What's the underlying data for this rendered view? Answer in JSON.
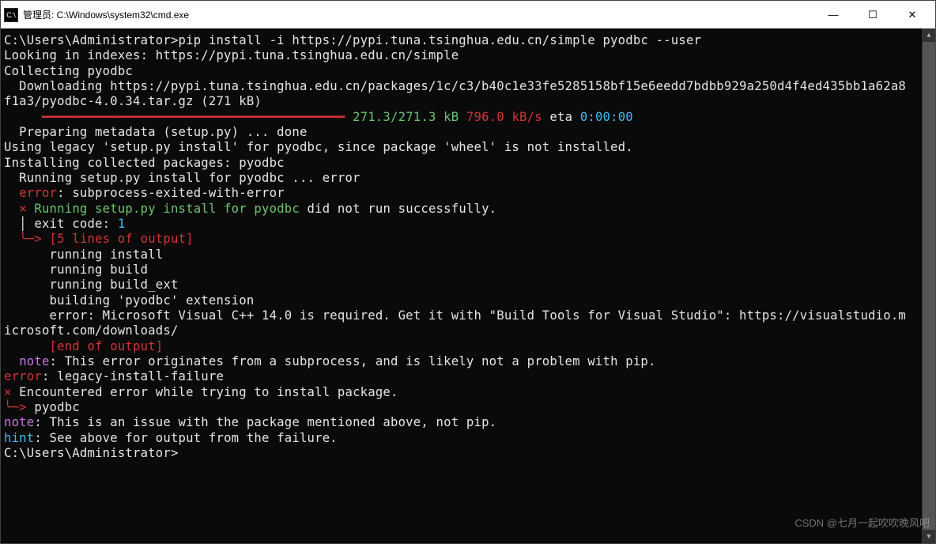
{
  "window": {
    "title": "管理员: C:\\Windows\\system32\\cmd.exe",
    "icon_label": "C:\\",
    "minimize": "—",
    "maximize": "☐",
    "close": "✕"
  },
  "scroll": {
    "up": "▲",
    "down": "▼"
  },
  "colors": {
    "red": "#d13438",
    "green": "#6bc46d",
    "cyan": "#3abff8",
    "magenta": "#c678dd",
    "white": "#e5e5e5"
  },
  "lines": [
    [
      {
        "t": "C:\\Users\\Administrator>pip install -i https://pypi.tuna.tsinghua.edu.cn/simple pyodbc --user",
        "c": "white"
      }
    ],
    [
      {
        "t": "Looking in indexes: https://pypi.tuna.tsinghua.edu.cn/simple",
        "c": "white"
      }
    ],
    [
      {
        "t": "Collecting pyodbc",
        "c": "white"
      }
    ],
    [
      {
        "t": "  Downloading https://pypi.tuna.tsinghua.edu.cn/packages/1c/c3/b40c1e33fe5285158bf15e6eedd7bdbb929a250d4f4ed435bb1a62a8f1a3/pyodbc-4.0.34.tar.gz (271 kB)",
        "c": "white"
      }
    ],
    [
      {
        "t": "     ",
        "c": "white"
      },
      {
        "t": "━━━━━━━━━━━━━━━━━━━━━━━━━━━━━━━━━━━━━━━━",
        "c": "red"
      },
      {
        "t": " ",
        "c": "white"
      },
      {
        "t": "271.3/271.3 kB",
        "c": "green"
      },
      {
        "t": " ",
        "c": "white"
      },
      {
        "t": "796.0 kB/s",
        "c": "red"
      },
      {
        "t": " eta ",
        "c": "white"
      },
      {
        "t": "0:00:00",
        "c": "cyan"
      }
    ],
    [
      {
        "t": "  Preparing metadata (setup.py) ... done",
        "c": "white"
      }
    ],
    [
      {
        "t": "Using legacy 'setup.py install' for pyodbc, since package 'wheel' is not installed.",
        "c": "white"
      }
    ],
    [
      {
        "t": "Installing collected packages: pyodbc",
        "c": "white"
      }
    ],
    [
      {
        "t": "  Running setup.py install for pyodbc ... error",
        "c": "white"
      }
    ],
    [
      {
        "t": "  ",
        "c": "white"
      },
      {
        "t": "error",
        "c": "red"
      },
      {
        "t": ": subprocess-exited-with-error",
        "c": "white"
      }
    ],
    [
      {
        "t": "",
        "c": "white"
      }
    ],
    [
      {
        "t": "  ",
        "c": "white"
      },
      {
        "t": "×",
        "c": "red"
      },
      {
        "t": " ",
        "c": "white"
      },
      {
        "t": "Running setup.py install for pyodbc",
        "c": "green"
      },
      {
        "t": " did not run successfully.",
        "c": "white"
      }
    ],
    [
      {
        "t": "  │ exit code: ",
        "c": "white"
      },
      {
        "t": "1",
        "c": "cyan"
      }
    ],
    [
      {
        "t": "  ",
        "c": "white"
      },
      {
        "t": "╰─>",
        "c": "red"
      },
      {
        "t": " ",
        "c": "white"
      },
      {
        "t": "[5 lines of output]",
        "c": "red"
      }
    ],
    [
      {
        "t": "      running install",
        "c": "white"
      }
    ],
    [
      {
        "t": "      running build",
        "c": "white"
      }
    ],
    [
      {
        "t": "      running build_ext",
        "c": "white"
      }
    ],
    [
      {
        "t": "      building 'pyodbc' extension",
        "c": "white"
      }
    ],
    [
      {
        "t": "      error: Microsoft Visual C++ 14.0 is required. Get it with \"Build Tools for Visual Studio\": https://visualstudio.microsoft.com/downloads/",
        "c": "white"
      }
    ],
    [
      {
        "t": "      ",
        "c": "white"
      },
      {
        "t": "[end of output]",
        "c": "red"
      }
    ],
    [
      {
        "t": "",
        "c": "white"
      }
    ],
    [
      {
        "t": "  ",
        "c": "white"
      },
      {
        "t": "note",
        "c": "magenta"
      },
      {
        "t": ": This error originates from a subprocess, and is likely not a problem with pip.",
        "c": "white"
      }
    ],
    [
      {
        "t": "error",
        "c": "red"
      },
      {
        "t": ": legacy-install-failure",
        "c": "white"
      }
    ],
    [
      {
        "t": "",
        "c": "white"
      }
    ],
    [
      {
        "t": "×",
        "c": "red"
      },
      {
        "t": " Encountered error while trying to install package.",
        "c": "white"
      }
    ],
    [
      {
        "t": "╰─>",
        "c": "red"
      },
      {
        "t": " pyodbc",
        "c": "white"
      }
    ],
    [
      {
        "t": "",
        "c": "white"
      }
    ],
    [
      {
        "t": "note",
        "c": "magenta"
      },
      {
        "t": ": This is an issue with the package mentioned above, not pip.",
        "c": "white"
      }
    ],
    [
      {
        "t": "hint",
        "c": "cyan"
      },
      {
        "t": ": See above for output from the failure.",
        "c": "white"
      }
    ],
    [
      {
        "t": "",
        "c": "white"
      }
    ],
    [
      {
        "t": "C:\\Users\\Administrator>",
        "c": "white"
      }
    ]
  ],
  "watermark": "CSDN @七月一起吹吹晚风吧"
}
